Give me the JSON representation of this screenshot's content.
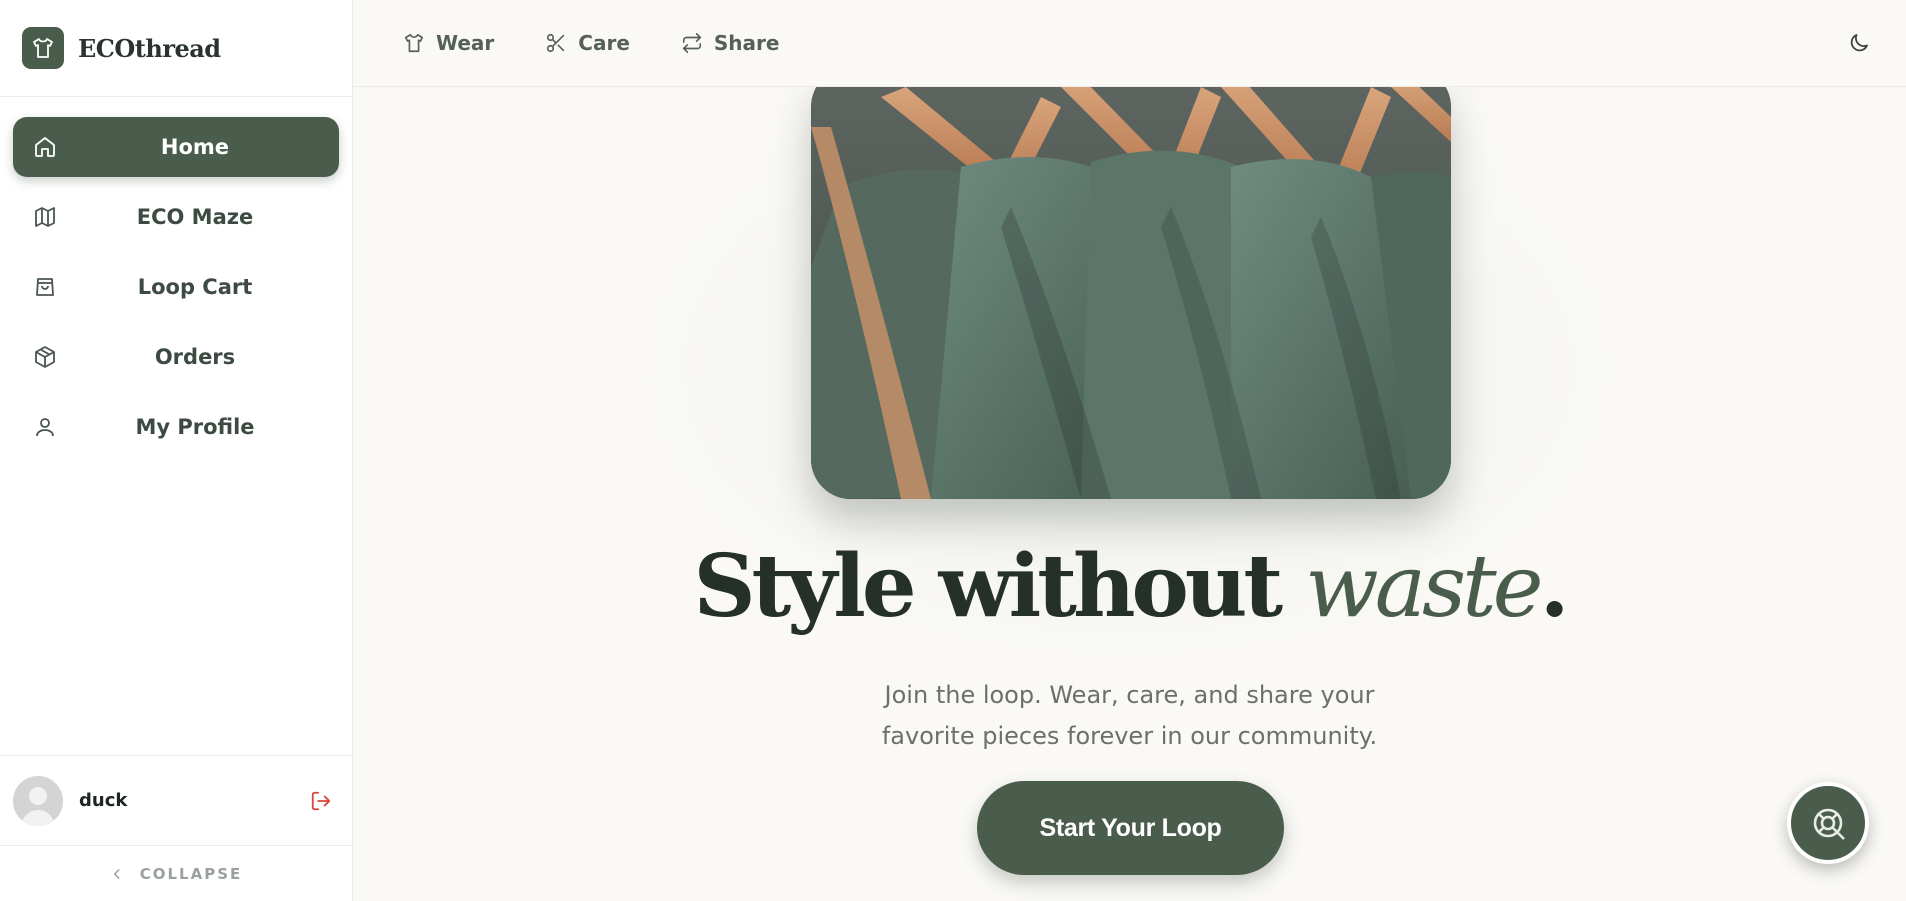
{
  "brand": {
    "name": "ECOthread",
    "icon": "shirt-icon"
  },
  "sidebar": {
    "items": [
      {
        "label": "Home",
        "icon": "home-icon",
        "active": true
      },
      {
        "label": "ECO Maze",
        "icon": "map-icon",
        "active": false
      },
      {
        "label": "Loop Cart",
        "icon": "shopping-bag-icon",
        "active": false
      },
      {
        "label": "Orders",
        "icon": "package-icon",
        "active": false
      },
      {
        "label": "My Profile",
        "icon": "user-icon",
        "active": false
      }
    ],
    "user": {
      "name": "duck"
    },
    "collapse_label": "COLLAPSE"
  },
  "topbar": {
    "links": [
      {
        "label": "Wear",
        "icon": "shirt-icon"
      },
      {
        "label": "Care",
        "icon": "scissors-icon"
      },
      {
        "label": "Share",
        "icon": "repeat-icon"
      }
    ],
    "theme_icon": "moon-icon"
  },
  "hero": {
    "headline_main": "Style without ",
    "headline_accent": "waste",
    "headline_end": ".",
    "subtitle_line1": "Join the loop. Wear, care, and share your",
    "subtitle_line2": "favorite pieces forever in our community.",
    "cta_label": "Start Your Loop"
  },
  "colors": {
    "brand": "#4a5d4c",
    "background": "#faf9f6",
    "logout": "#d9463b"
  }
}
